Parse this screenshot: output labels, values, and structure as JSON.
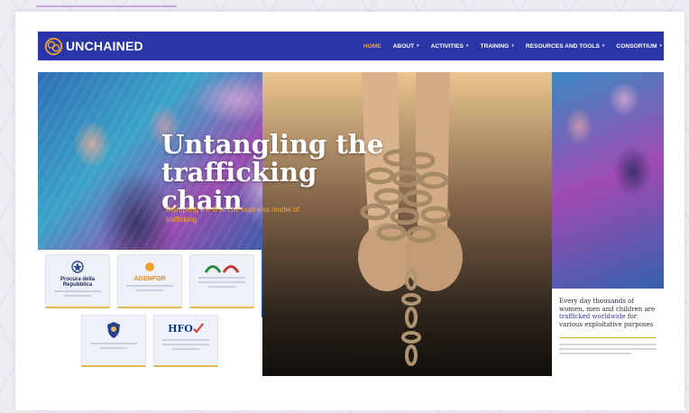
{
  "brand": {
    "name": "UNCHAINED"
  },
  "nav": {
    "items": [
      {
        "label": "HOME",
        "active": true,
        "dropdown": false
      },
      {
        "label": "ABOUT",
        "active": false,
        "dropdown": true
      },
      {
        "label": "ACTIVITIES",
        "active": false,
        "dropdown": true
      },
      {
        "label": "TRAINING",
        "active": false,
        "dropdown": true
      },
      {
        "label": "RESOURCES AND TOOLS",
        "active": false,
        "dropdown": true
      },
      {
        "label": "CONSORTIUM",
        "active": false,
        "dropdown": true
      }
    ],
    "caret": "▾"
  },
  "hero": {
    "title_line1": "Untangling the",
    "title_line2": "trafficking chain",
    "subtitle": "Disrupting the financial business model of trafficking"
  },
  "partners": {
    "cards": [
      {
        "name": "Procura della Repubblica",
        "icon": "emblem-icon"
      },
      {
        "name": "AGENFOR",
        "icon": "agenfor-logo-icon"
      },
      {
        "name": "",
        "icon": "arches-logo-icon"
      },
      {
        "name": "",
        "icon": "police-shield-icon"
      },
      {
        "name": "HFO",
        "icon": "hfo-logo-icon"
      }
    ]
  },
  "info": {
    "text_before": "Every day thousands of women, men and children are ",
    "highlight": "trafficked worldwide",
    "text_after": " for various exploitative purposes"
  },
  "colors": {
    "nav_bg": "#2a35a8",
    "nav_active": "#f2a531",
    "accent_gold": "#e2b85a",
    "highlight_blue": "#2a35a8"
  }
}
